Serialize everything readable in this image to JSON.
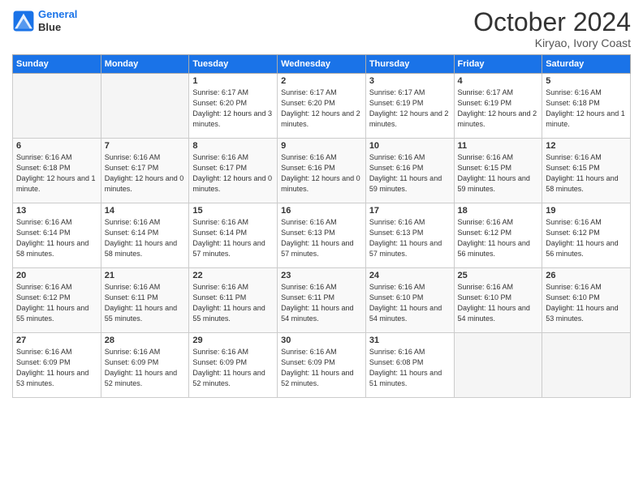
{
  "logo": {
    "line1": "General",
    "line2": "Blue"
  },
  "title": "October 2024",
  "location": "Kiryao, Ivory Coast",
  "days_of_week": [
    "Sunday",
    "Monday",
    "Tuesday",
    "Wednesday",
    "Thursday",
    "Friday",
    "Saturday"
  ],
  "weeks": [
    [
      {
        "day": "",
        "info": ""
      },
      {
        "day": "",
        "info": ""
      },
      {
        "day": "1",
        "info": "Sunrise: 6:17 AM\nSunset: 6:20 PM\nDaylight: 12 hours and 3 minutes."
      },
      {
        "day": "2",
        "info": "Sunrise: 6:17 AM\nSunset: 6:20 PM\nDaylight: 12 hours and 2 minutes."
      },
      {
        "day": "3",
        "info": "Sunrise: 6:17 AM\nSunset: 6:19 PM\nDaylight: 12 hours and 2 minutes."
      },
      {
        "day": "4",
        "info": "Sunrise: 6:17 AM\nSunset: 6:19 PM\nDaylight: 12 hours and 2 minutes."
      },
      {
        "day": "5",
        "info": "Sunrise: 6:16 AM\nSunset: 6:18 PM\nDaylight: 12 hours and 1 minute."
      }
    ],
    [
      {
        "day": "6",
        "info": "Sunrise: 6:16 AM\nSunset: 6:18 PM\nDaylight: 12 hours and 1 minute."
      },
      {
        "day": "7",
        "info": "Sunrise: 6:16 AM\nSunset: 6:17 PM\nDaylight: 12 hours and 0 minutes."
      },
      {
        "day": "8",
        "info": "Sunrise: 6:16 AM\nSunset: 6:17 PM\nDaylight: 12 hours and 0 minutes."
      },
      {
        "day": "9",
        "info": "Sunrise: 6:16 AM\nSunset: 6:16 PM\nDaylight: 12 hours and 0 minutes."
      },
      {
        "day": "10",
        "info": "Sunrise: 6:16 AM\nSunset: 6:16 PM\nDaylight: 11 hours and 59 minutes."
      },
      {
        "day": "11",
        "info": "Sunrise: 6:16 AM\nSunset: 6:15 PM\nDaylight: 11 hours and 59 minutes."
      },
      {
        "day": "12",
        "info": "Sunrise: 6:16 AM\nSunset: 6:15 PM\nDaylight: 11 hours and 58 minutes."
      }
    ],
    [
      {
        "day": "13",
        "info": "Sunrise: 6:16 AM\nSunset: 6:14 PM\nDaylight: 11 hours and 58 minutes."
      },
      {
        "day": "14",
        "info": "Sunrise: 6:16 AM\nSunset: 6:14 PM\nDaylight: 11 hours and 58 minutes."
      },
      {
        "day": "15",
        "info": "Sunrise: 6:16 AM\nSunset: 6:14 PM\nDaylight: 11 hours and 57 minutes."
      },
      {
        "day": "16",
        "info": "Sunrise: 6:16 AM\nSunset: 6:13 PM\nDaylight: 11 hours and 57 minutes."
      },
      {
        "day": "17",
        "info": "Sunrise: 6:16 AM\nSunset: 6:13 PM\nDaylight: 11 hours and 57 minutes."
      },
      {
        "day": "18",
        "info": "Sunrise: 6:16 AM\nSunset: 6:12 PM\nDaylight: 11 hours and 56 minutes."
      },
      {
        "day": "19",
        "info": "Sunrise: 6:16 AM\nSunset: 6:12 PM\nDaylight: 11 hours and 56 minutes."
      }
    ],
    [
      {
        "day": "20",
        "info": "Sunrise: 6:16 AM\nSunset: 6:12 PM\nDaylight: 11 hours and 55 minutes."
      },
      {
        "day": "21",
        "info": "Sunrise: 6:16 AM\nSunset: 6:11 PM\nDaylight: 11 hours and 55 minutes."
      },
      {
        "day": "22",
        "info": "Sunrise: 6:16 AM\nSunset: 6:11 PM\nDaylight: 11 hours and 55 minutes."
      },
      {
        "day": "23",
        "info": "Sunrise: 6:16 AM\nSunset: 6:11 PM\nDaylight: 11 hours and 54 minutes."
      },
      {
        "day": "24",
        "info": "Sunrise: 6:16 AM\nSunset: 6:10 PM\nDaylight: 11 hours and 54 minutes."
      },
      {
        "day": "25",
        "info": "Sunrise: 6:16 AM\nSunset: 6:10 PM\nDaylight: 11 hours and 54 minutes."
      },
      {
        "day": "26",
        "info": "Sunrise: 6:16 AM\nSunset: 6:10 PM\nDaylight: 11 hours and 53 minutes."
      }
    ],
    [
      {
        "day": "27",
        "info": "Sunrise: 6:16 AM\nSunset: 6:09 PM\nDaylight: 11 hours and 53 minutes."
      },
      {
        "day": "28",
        "info": "Sunrise: 6:16 AM\nSunset: 6:09 PM\nDaylight: 11 hours and 52 minutes."
      },
      {
        "day": "29",
        "info": "Sunrise: 6:16 AM\nSunset: 6:09 PM\nDaylight: 11 hours and 52 minutes."
      },
      {
        "day": "30",
        "info": "Sunrise: 6:16 AM\nSunset: 6:09 PM\nDaylight: 11 hours and 52 minutes."
      },
      {
        "day": "31",
        "info": "Sunrise: 6:16 AM\nSunset: 6:08 PM\nDaylight: 11 hours and 51 minutes."
      },
      {
        "day": "",
        "info": ""
      },
      {
        "day": "",
        "info": ""
      }
    ]
  ]
}
